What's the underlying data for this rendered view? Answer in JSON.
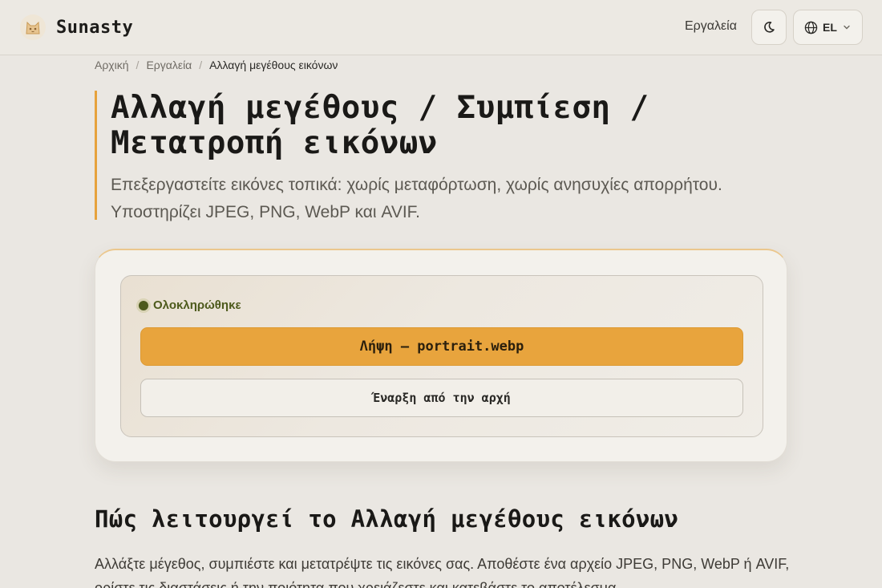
{
  "header": {
    "brand": "Sunasty",
    "nav_tools": "Εργαλεία",
    "lang_code": "EL",
    "icons": {
      "logo": "cat-logo-icon",
      "theme": "moon-icon",
      "lang": "globe-icon",
      "dropdown": "chevron-down-icon"
    }
  },
  "breadcrumb": {
    "home": "Αρχική",
    "tools": "Εργαλεία",
    "current": "Αλλαγή μεγέθους εικόνων",
    "separator": "/"
  },
  "hero": {
    "title": "Αλλαγή μεγέθους / Συμπίεση / Μετατροπή εικόνων",
    "subtitle": "Επεξεργαστείτε εικόνες τοπικά: χωρίς μεταφόρτωση, χωρίς ανησυχίες απορρήτου. Υποστηρίζει JPEG, PNG, WebP και AVIF."
  },
  "result": {
    "status": "Ολοκληρώθηκε",
    "download_label": "Λήψη — portrait.webp",
    "restart_label": "Έναρξη από την αρχή"
  },
  "how": {
    "title": "Πώς λειτουργεί το Αλλαγή μεγέθους εικόνων",
    "text": "Αλλάξτε μέγεθος, συμπιέστε και μετατρέψτε τις εικόνες σας. Αποθέστε ένα αρχείο JPEG, PNG, WebP ή AVIF, ορίστε τις διαστάσεις ή την ποιότητα που χρειάζεστε και κατεβάστε το αποτέλεσμα."
  },
  "colors": {
    "accent": "#e8a43d",
    "background": "#eae7e2",
    "status": "#4d5a1c"
  }
}
